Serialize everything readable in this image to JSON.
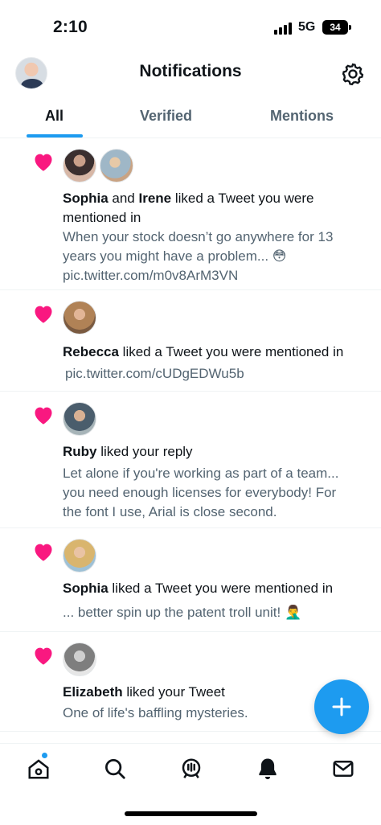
{
  "status": {
    "time": "2:10",
    "network": "5G",
    "battery": "34"
  },
  "header": {
    "title": "Notifications"
  },
  "tabs": [
    {
      "label": "All",
      "active": true
    },
    {
      "label": "Verified",
      "active": false
    },
    {
      "label": "Mentions",
      "active": false
    }
  ],
  "notifications": [
    {
      "actor1": "Sophia",
      "connector": " and ",
      "actor2": "Irene",
      "action": " liked a Tweet you were",
      "action_line2": "mentioned in",
      "body_line1": "When your stock doesn’t go anywhere for 13",
      "body_line2": "years you might have a problem... 😳",
      "link": "pic.twitter.com/m0v8ArM3VN"
    },
    {
      "actor": "Rebecca",
      "action": " liked a Tweet you were mentioned in",
      "link": "pic.twitter.com/cUDgEDWu5b"
    },
    {
      "actor": "Ruby",
      "action": " liked your reply",
      "body_line1": "Let alone if you're working as part of a team...",
      "body_line2": "you need enough licenses for everybody! For",
      "body_line3": "the font I use, Arial is close second."
    },
    {
      "actor": "Sophia",
      "action": " liked a Tweet you were mentioned in",
      "body_line1": "... better spin up the patent troll unit! 🤦‍♂️"
    },
    {
      "actor": "Elizabeth",
      "action": " liked your Tweet",
      "body_line1": "One of life's baffling mysteries."
    }
  ],
  "fab": {
    "icon": "plus-icon"
  },
  "bottom_nav": [
    "home-icon",
    "search-icon",
    "spaces-icon",
    "bell-icon",
    "mail-icon"
  ],
  "colors": {
    "accent": "#1d9bf0",
    "heart": "#f91880",
    "muted": "#536471"
  }
}
